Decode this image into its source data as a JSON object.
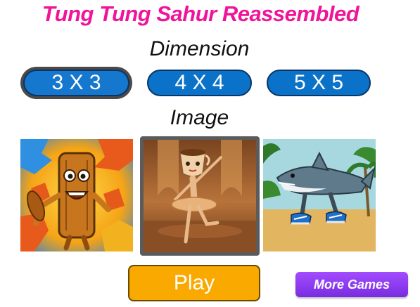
{
  "game": {
    "title": "Tung Tung Sahur Reassembled",
    "title_color": "#f0149b"
  },
  "dimension": {
    "label": "Dimension",
    "options": [
      "3 X 3",
      "4 X 4",
      "5 X 5"
    ],
    "selected": "3 X 3"
  },
  "image": {
    "label": "Image",
    "thumbnails": [
      {
        "icon": "tung-tung-sahur-wooden-log-puzzle-icon"
      },
      {
        "icon": "ballerina-cappuccina-icon"
      },
      {
        "icon": "shark-in-sneakers-icon"
      }
    ],
    "selected_index": 1
  },
  "actions": {
    "play_label": "Play",
    "more_games_label": "More Games"
  },
  "colors": {
    "dimension_button": "#0b72c9",
    "play_button": "#f9a900",
    "more_games_button": "#8a3df0"
  }
}
